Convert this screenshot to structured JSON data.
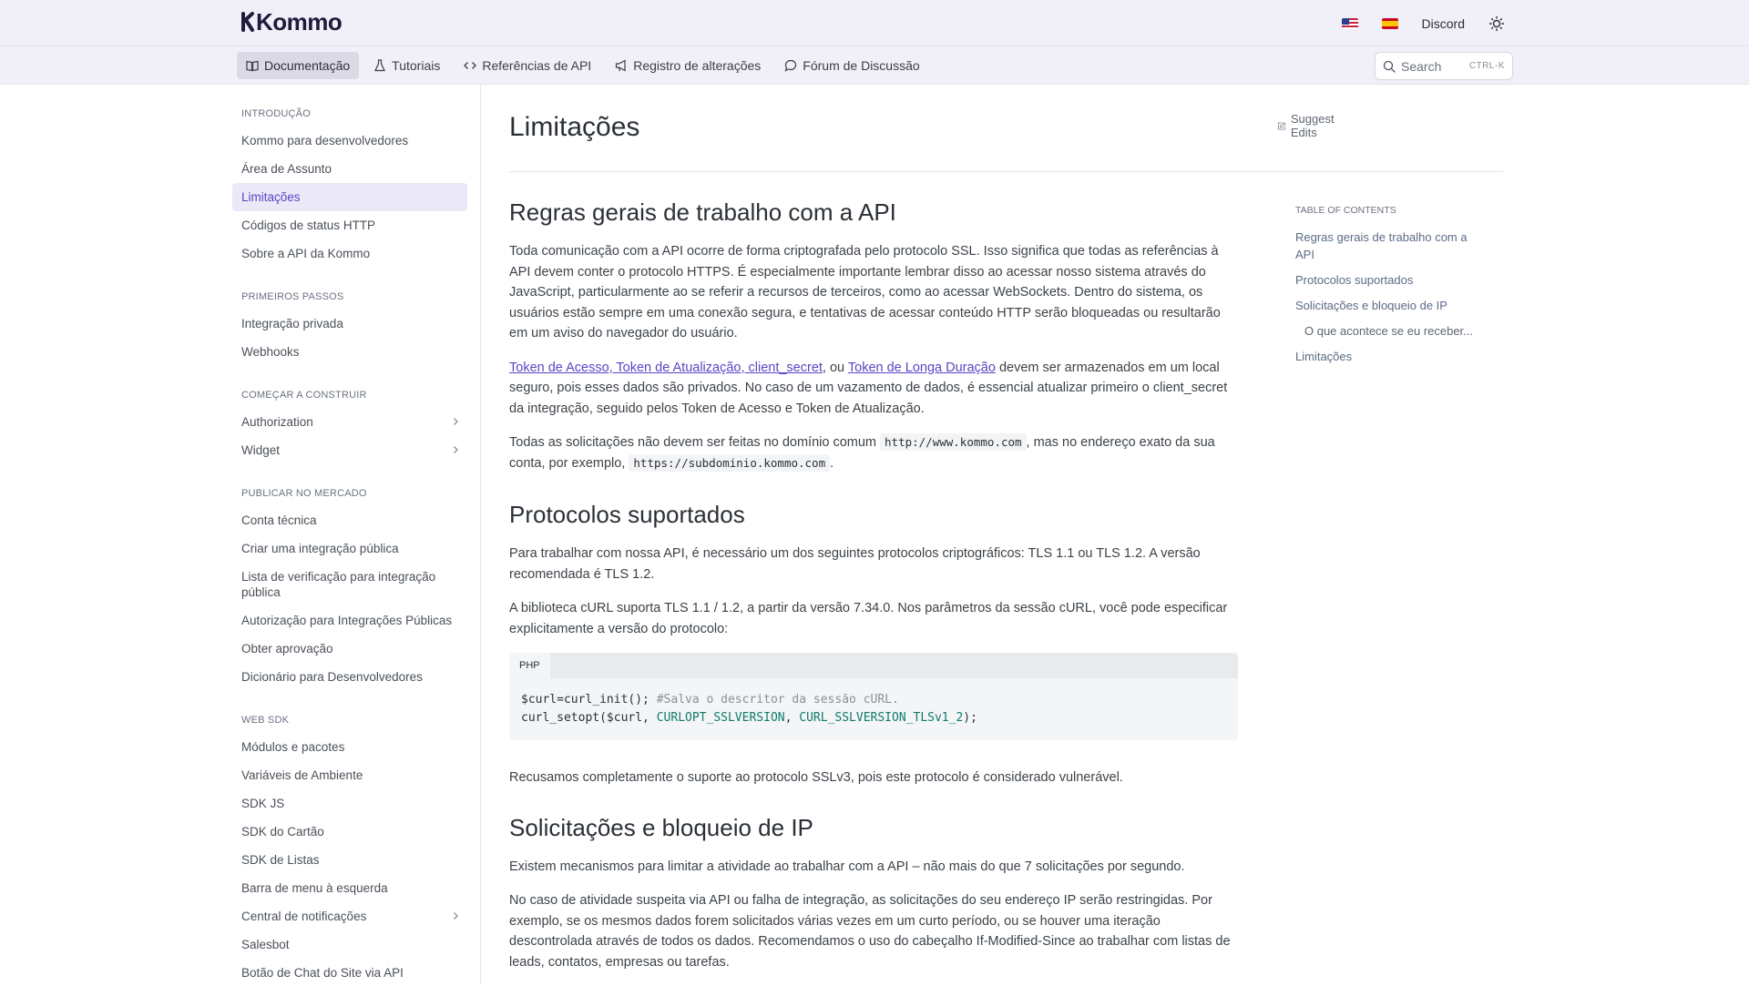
{
  "header": {
    "logo": "Kommo",
    "links": {
      "discord": "Discord"
    },
    "icons": {
      "flag_us": "flag-us-icon",
      "flag_es": "flag-es-icon",
      "theme": "sun-icon"
    }
  },
  "nav": {
    "tabs": [
      {
        "label": "Documentação",
        "icon": "book-icon",
        "active": true
      },
      {
        "label": "Tutoriais",
        "icon": "flask-icon"
      },
      {
        "label": "Referências de API",
        "icon": "code-icon"
      },
      {
        "label": "Registro de alterações",
        "icon": "megaphone-icon"
      },
      {
        "label": "Fórum de Discussão",
        "icon": "chat-icon"
      }
    ],
    "search": {
      "placeholder": "Search",
      "shortcut": "CTRL-K"
    }
  },
  "sidebar": {
    "sections": [
      {
        "title": "INTRODUÇÃO",
        "items": [
          "Kommo para desenvolvedores",
          "Área de Assunto",
          "Limitações",
          "Códigos de status HTTP",
          "Sobre a API da Kommo"
        ]
      },
      {
        "title": "PRIMEIROS PASSOS",
        "items": [
          "Integração privada",
          "Webhooks"
        ]
      },
      {
        "title": "COMEÇAR A CONSTRUIR",
        "items": [
          "Authorization",
          "Widget"
        ]
      },
      {
        "title": "PUBLICAR NO MERCADO",
        "items": [
          "Conta técnica",
          "Criar uma integração pública",
          "Lista de verificação para integração pública",
          "Autorização para Integrações Públicas",
          "Obter aprovação",
          "Dicionário para Desenvolvedores"
        ]
      },
      {
        "title": "WEB SDK",
        "items": [
          "Módulos e pacotes",
          "Variáveis de Ambiente",
          "SDK JS",
          "SDK do Cartão",
          "SDK de Listas",
          "Barra de menu à esquerda",
          "Central de notificações",
          "Salesbot",
          "Botão de Chat do Site via API"
        ]
      }
    ],
    "active_item": "Limitações"
  },
  "page": {
    "title": "Limitações",
    "suggest_edits": "Suggest Edits",
    "sections": {
      "s1_title": "Regras gerais de trabalho com a API",
      "s1_p1": "Toda comunicação com a API ocorre de forma criptografada pelo protocolo SSL. Isso significa que todas as referências à API devem conter o protocolo HTTPS. É especialmente importante lembrar disso ao acessar nosso sistema através do JavaScript, particularmente ao se referir a recursos de terceiros, como ao acessar WebSockets. Dentro do sistema, os usuários estão sempre em uma conexão segura, e tentativas de acessar conteúdo HTTP serão bloqueadas ou resultarão em um aviso do navegador do usuário.",
      "s1_p2_link1": "Token de Acesso, Token de Atualização, client_secret",
      "s1_p2_mid": ", ou ",
      "s1_p2_link2": "Token de Longa Duração",
      "s1_p2_rest": " devem ser armazenados em um local seguro, pois esses dados são privados. No caso de um vazamento de dados, é essencial atualizar primeiro o client_secret da integração, seguido pelos Token de Acesso e Token de Atualização.",
      "s1_p3_a": "Todas as solicitações não devem ser feitas no domínio comum ",
      "s1_p3_code1": "http://www.kommo.com",
      "s1_p3_b": ", mas no endereço exato da sua conta, por exemplo, ",
      "s1_p3_code2": "https://subdominio.kommo.com",
      "s1_p3_c": ".",
      "s2_title": "Protocolos suportados",
      "s2_p1": "Para trabalhar com nossa API, é necessário um dos seguintes protocolos criptográficos: TLS 1.1 ou TLS 1.2. A versão recomendada é TLS 1.2.",
      "s2_p2": "A biblioteca cURL suporta TLS 1.1 / 1.2, a partir da versão 7.34.0. Nos parâmetros da sessão cURL, você pode especificar explicitamente a versão do protocolo:",
      "code_lang": "PHP",
      "code_l1_a": "$curl=curl_init(); ",
      "code_l1_comment": "#Salva o descritor da sessão cURL.",
      "code_l2_a": "curl_setopt($curl, ",
      "code_l2_c1": "CURLOPT_SSLVERSION",
      "code_l2_b": ", ",
      "code_l2_c2": "CURL_SSLVERSION_TLSv1_2",
      "code_l2_end": ");",
      "s2_p3": "Recusamos completamente o suporte ao protocolo SSLv3, pois este protocolo é considerado vulnerável.",
      "s3_title": "Solicitações e bloqueio de IP",
      "s3_p1": "Existem mecanismos para limitar a atividade ao trabalhar com a API – não mais do que 7 solicitações por segundo.",
      "s3_p2": "No caso de atividade suspeita via API ou falha de integração, as solicitações do seu endereço IP serão restringidas. Por exemplo, se os mesmos dados forem solicitados várias vezes em um curto período, ou se houver uma iteração descontrolada através de todos os dados. Recomendamos o uso do cabeçalho If-Modified-Since ao trabalhar com listas de leads, contatos, empresas ou tarefas."
    }
  },
  "toc": {
    "title": "TABLE OF CONTENTS",
    "items": [
      {
        "label": "Regras gerais de trabalho com a API"
      },
      {
        "label": "Protocolos suportados"
      },
      {
        "label": "Solicitações e bloqueio de IP"
      },
      {
        "label": "O que acontece se eu receber...",
        "sub": true
      },
      {
        "label": "Limitações"
      }
    ]
  },
  "colors": {
    "accent": "#5b45c5",
    "header_bg": "#f1eff8",
    "code_const": "#0f7b6c"
  }
}
